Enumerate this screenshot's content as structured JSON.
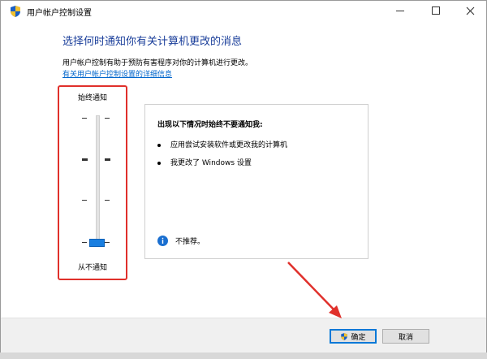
{
  "window": {
    "title": "用户帐户控制设置",
    "controls": {
      "minimize": "minimize",
      "maximize": "maximize",
      "close": "close"
    }
  },
  "main": {
    "heading": "选择何时通知你有关计算机更改的消息",
    "description": "用户帐户控制有助于预防有害程序对你的计算机进行更改。",
    "help_link": "有关用户帐户控制设置的详细信息"
  },
  "slider": {
    "top_label": "始终通知",
    "bottom_label": "从不通知",
    "level": 0,
    "levels": 4
  },
  "info_panel": {
    "heading": "出现以下情况时始终不要通知我:",
    "bullets": [
      "应用尝试安装软件或更改我的计算机",
      "我更改了 Windows 设置"
    ],
    "recommendation": "不推荐。"
  },
  "buttons": {
    "ok": "确定",
    "cancel": "取消"
  },
  "colors": {
    "heading": "#1a3e9a",
    "link": "#0066cc",
    "accent": "#1a7fe0",
    "highlight": "#e0302b"
  }
}
